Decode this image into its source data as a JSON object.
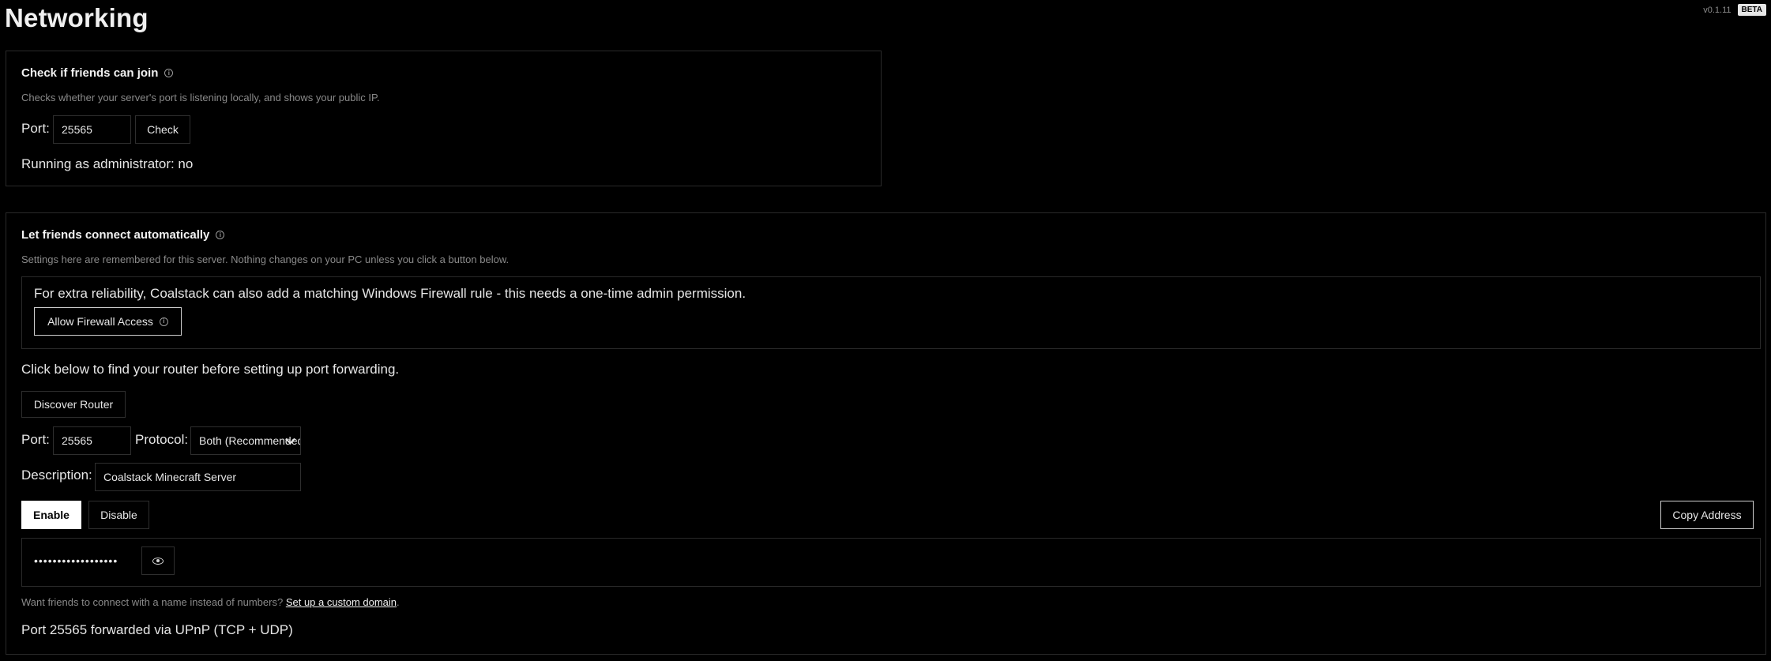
{
  "header": {
    "title": "Networking",
    "version": "v0.1.11",
    "badge": "BETA"
  },
  "check_section": {
    "title": "Check if friends can join",
    "description": "Checks whether your server's port is listening locally, and shows your public IP.",
    "port_label": "Port:",
    "port_value": "25565",
    "check_button": "Check",
    "admin_status": "Running as administrator: no"
  },
  "connect_section": {
    "title": "Let friends connect automatically",
    "description": "Settings here are remembered for this server. Nothing changes on your PC unless you click a button below.",
    "firewall": {
      "text": "For extra reliability, Coalstack can also add a matching Windows Firewall rule - this needs a one-time admin permission.",
      "button": "Allow Firewall Access"
    },
    "router_hint": "Click below to find your router before setting up port forwarding.",
    "discover_button": "Discover Router",
    "port_label": "Port:",
    "port_value": "25565",
    "protocol_label": "Protocol:",
    "protocol_value": "Both (Recommended)",
    "description_label": "Description:",
    "description_value": "Coalstack Minecraft Server",
    "enable_button": "Enable",
    "disable_button": "Disable",
    "copy_button": "Copy Address",
    "masked_address": "••••••••••••••••••",
    "custom_domain_prefix": "Want friends to connect with a name instead of numbers?",
    "custom_domain_link": "Set up a custom domain",
    "custom_domain_suffix": ".",
    "forward_status": "Port 25565 forwarded via UPnP (TCP + UDP)"
  }
}
